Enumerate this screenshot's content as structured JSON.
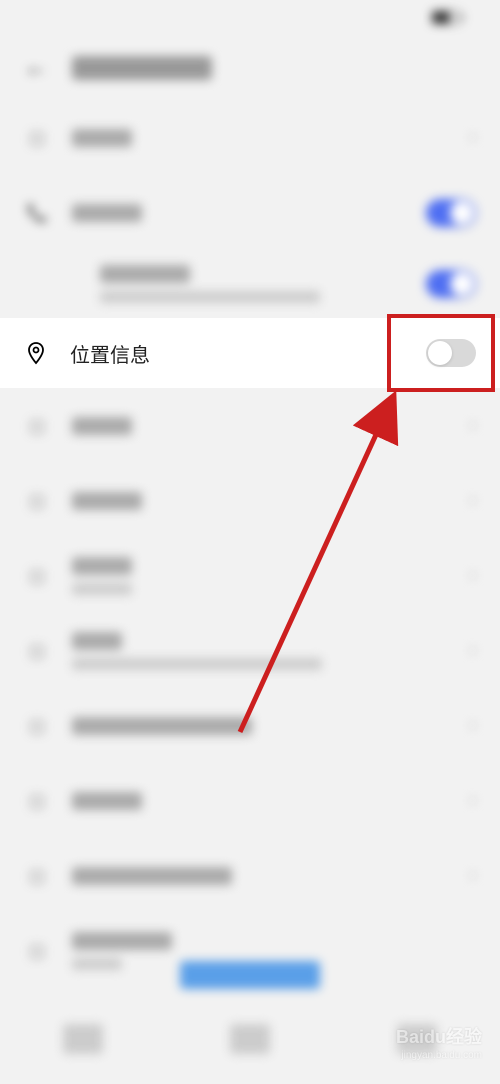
{
  "status": {
    "time": "",
    "battery": ""
  },
  "header": {
    "title": ""
  },
  "highlighted": {
    "label": "位置信息",
    "toggle_state": "off"
  },
  "rows": [
    {
      "icon": "message-icon",
      "label": "",
      "control": "chevron"
    },
    {
      "icon": "phone-icon",
      "label": "",
      "control": "toggle-on"
    },
    {
      "icon": "",
      "label": "",
      "sub": "",
      "control": "toggle-on",
      "indent": true
    },
    {
      "icon": "location-icon",
      "label": "位置信息",
      "control": "toggle-off",
      "highlight": true
    },
    {
      "icon": "camera-icon",
      "label": "",
      "control": "chevron"
    },
    {
      "icon": "mic-icon",
      "label": "",
      "control": "chevron"
    },
    {
      "icon": "bell-icon",
      "label": "",
      "sub": "",
      "control": "chevron"
    },
    {
      "icon": "storage-icon",
      "label": "",
      "sub": "",
      "control": "chevron"
    },
    {
      "icon": "overlay-icon",
      "label": "",
      "control": "chevron"
    },
    {
      "icon": "file-icon",
      "label": "",
      "control": "chevron"
    },
    {
      "icon": "settings-icon",
      "label": "",
      "control": "chevron"
    },
    {
      "icon": "link-icon",
      "label": "",
      "sub": "",
      "control": ""
    }
  ],
  "bottom_action": {
    "label": ""
  },
  "watermark": {
    "brand": "Baidu经验",
    "sub": "jingyan.baidu.com"
  }
}
